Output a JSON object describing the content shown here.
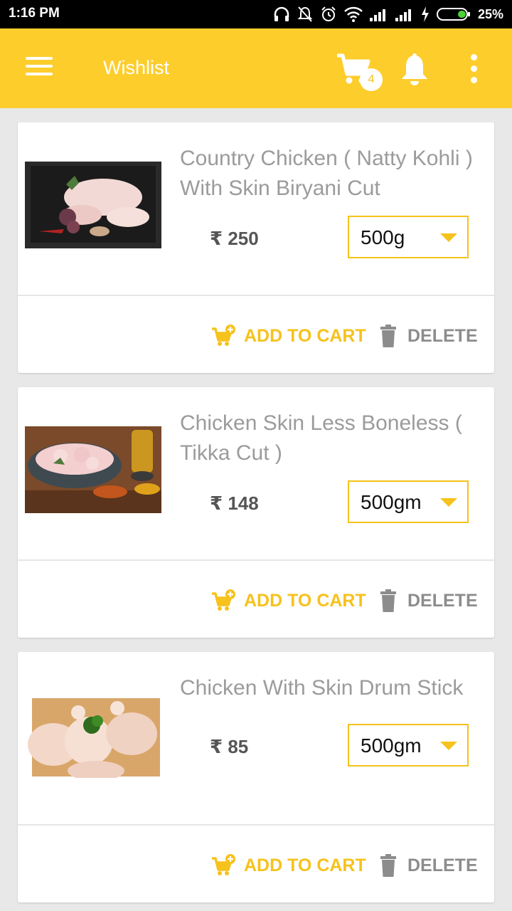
{
  "status_bar": {
    "time": "1:16 PM",
    "battery": "25%"
  },
  "app_bar": {
    "title": "Wishlist",
    "cart_count": "4"
  },
  "colors": {
    "accent": "#fdcd2c",
    "action": "#f6c21c",
    "muted": "#8c8c8c"
  },
  "items": [
    {
      "title": "Country Chicken ( Natty Kohli ) With Skin Biryani Cut",
      "price": "₹ 250",
      "weight": "500g",
      "add_label": "ADD TO CART",
      "delete_label": "DELETE"
    },
    {
      "title": "Chicken Skin Less Boneless ( Tikka Cut )",
      "price": "₹ 148",
      "weight": "500gm",
      "add_label": "ADD TO CART",
      "delete_label": "DELETE"
    },
    {
      "title": "Chicken With Skin Drum Stick",
      "price": "₹ 85",
      "weight": "500gm",
      "add_label": "ADD TO CART",
      "delete_label": "DELETE"
    }
  ]
}
